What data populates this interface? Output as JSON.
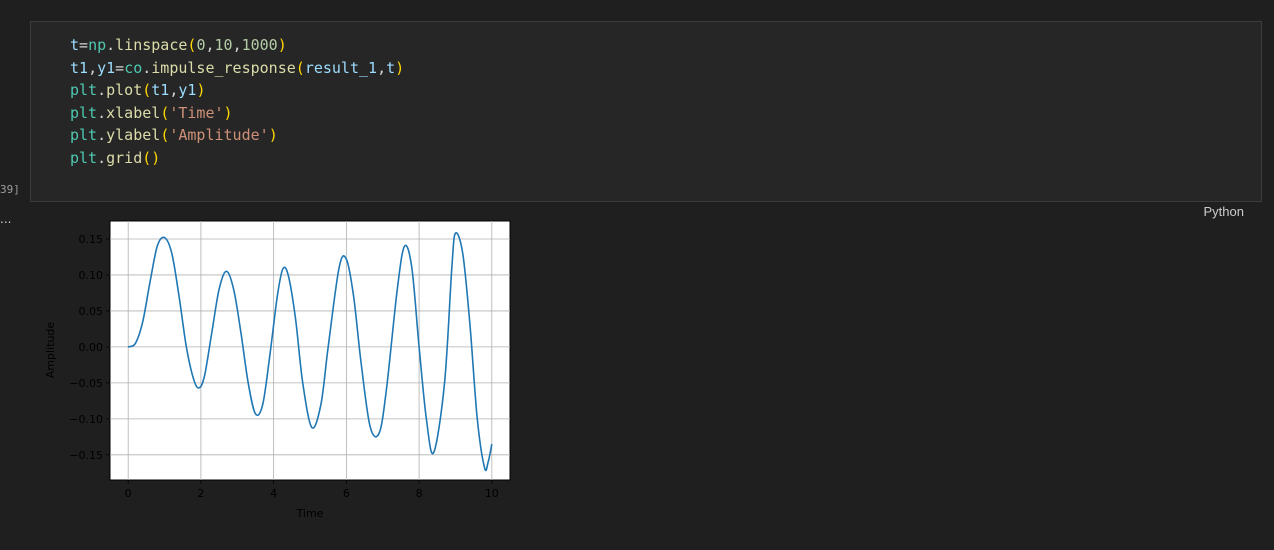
{
  "code_cell": {
    "execution_count": "39]",
    "language": "Python",
    "lines": [
      [
        {
          "t": "t",
          "c": "var"
        },
        {
          "t": "=",
          "c": "op"
        },
        {
          "t": "np",
          "c": "mod"
        },
        {
          "t": ".",
          "c": "op"
        },
        {
          "t": "linspace",
          "c": "fn"
        },
        {
          "t": "(",
          "c": "p1"
        },
        {
          "t": "0",
          "c": "num"
        },
        {
          "t": ",",
          "c": "op"
        },
        {
          "t": "10",
          "c": "num"
        },
        {
          "t": ",",
          "c": "op"
        },
        {
          "t": "1000",
          "c": "num"
        },
        {
          "t": ")",
          "c": "p1"
        }
      ],
      [
        {
          "t": "t1",
          "c": "var"
        },
        {
          "t": ",",
          "c": "op"
        },
        {
          "t": "y1",
          "c": "var"
        },
        {
          "t": "=",
          "c": "op"
        },
        {
          "t": "co",
          "c": "mod"
        },
        {
          "t": ".",
          "c": "op"
        },
        {
          "t": "impulse_response",
          "c": "fn"
        },
        {
          "t": "(",
          "c": "p1"
        },
        {
          "t": "result_1",
          "c": "var"
        },
        {
          "t": ",",
          "c": "op"
        },
        {
          "t": "t",
          "c": "var"
        },
        {
          "t": ")",
          "c": "p1"
        }
      ],
      [
        {
          "t": "plt",
          "c": "mod"
        },
        {
          "t": ".",
          "c": "op"
        },
        {
          "t": "plot",
          "c": "fn"
        },
        {
          "t": "(",
          "c": "p1"
        },
        {
          "t": "t1",
          "c": "var"
        },
        {
          "t": ",",
          "c": "op"
        },
        {
          "t": "y1",
          "c": "var"
        },
        {
          "t": ")",
          "c": "p1"
        }
      ],
      [
        {
          "t": "plt",
          "c": "mod"
        },
        {
          "t": ".",
          "c": "op"
        },
        {
          "t": "xlabel",
          "c": "fn"
        },
        {
          "t": "(",
          "c": "p1"
        },
        {
          "t": "'Time'",
          "c": "str"
        },
        {
          "t": ")",
          "c": "p1"
        }
      ],
      [
        {
          "t": "plt",
          "c": "mod"
        },
        {
          "t": ".",
          "c": "op"
        },
        {
          "t": "ylabel",
          "c": "fn"
        },
        {
          "t": "(",
          "c": "p1"
        },
        {
          "t": "'Amplitude'",
          "c": "str"
        },
        {
          "t": ")",
          "c": "p1"
        }
      ],
      [
        {
          "t": "plt",
          "c": "mod"
        },
        {
          "t": ".",
          "c": "op"
        },
        {
          "t": "grid",
          "c": "fn"
        },
        {
          "t": "()",
          "c": "p1"
        }
      ]
    ]
  },
  "output": {
    "more_indicator": "..."
  },
  "chart_data": {
    "type": "line",
    "title": "",
    "xlabel": "Time",
    "ylabel": "Amplitude",
    "xlim": [
      -0.5,
      10.5
    ],
    "ylim": [
      -0.185,
      0.175
    ],
    "x_ticks": [
      0,
      2,
      4,
      6,
      8,
      10
    ],
    "y_ticks": [
      0.15,
      0.1,
      0.05,
      0.0,
      -0.05,
      -0.1,
      -0.15
    ],
    "y_tick_labels": [
      "0.15",
      "0.10",
      "0.05",
      "0.00",
      "−0.05",
      "−0.10",
      "−0.15"
    ],
    "grid": true,
    "line_color": "#1f77b4",
    "series": [
      {
        "x": [
          0,
          0.2,
          0.4,
          0.6,
          0.8,
          1.0,
          1.2,
          1.4,
          1.6,
          1.8,
          1.95,
          2.1,
          2.3,
          2.5,
          2.7,
          2.9,
          3.1,
          3.3,
          3.5,
          3.7,
          3.9,
          4.1,
          4.25,
          4.4,
          4.6,
          4.8,
          5.05,
          5.3,
          5.5,
          5.8,
          6.0,
          6.2,
          6.4,
          6.65,
          6.9,
          7.1,
          7.4,
          7.6,
          7.8,
          8.0,
          8.2,
          8.4,
          8.7,
          8.9,
          9.0,
          9.2,
          9.4,
          9.6,
          9.8,
          9.9,
          10.0
        ],
        "y": [
          0.0,
          0.005,
          0.035,
          0.09,
          0.14,
          0.152,
          0.13,
          0.07,
          0.0,
          -0.045,
          -0.057,
          -0.04,
          0.02,
          0.08,
          0.105,
          0.08,
          0.02,
          -0.05,
          -0.093,
          -0.08,
          -0.01,
          0.07,
          0.108,
          0.1,
          0.04,
          -0.05,
          -0.112,
          -0.08,
          0.0,
          0.11,
          0.122,
          0.07,
          -0.02,
          -0.11,
          -0.12,
          -0.06,
          0.08,
          0.14,
          0.11,
          0.0,
          -0.1,
          -0.147,
          -0.05,
          0.11,
          0.158,
          0.13,
          0.03,
          -0.1,
          -0.168,
          -0.16,
          -0.135
        ]
      }
    ]
  }
}
